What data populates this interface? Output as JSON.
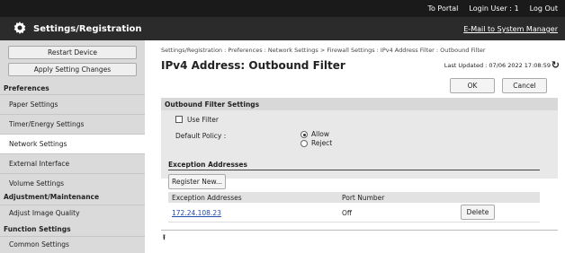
{
  "topbar": {
    "portal": "To Portal",
    "login_label": "Login User :",
    "login_user": "1",
    "logout": "Log Out"
  },
  "header": {
    "title": "Settings/Registration",
    "mail": "E-Mail to System Manager"
  },
  "sidebar": {
    "restart": "Restart Device",
    "apply": "Apply Setting Changes",
    "sections": {
      "preferences": "Preferences",
      "adjustment": "Adjustment/Maintenance",
      "function": "Function Settings"
    },
    "items": [
      "Paper Settings",
      "Timer/Energy Settings",
      "Network Settings",
      "External Interface",
      "Volume Settings",
      "Adjust Image Quality",
      "Common Settings"
    ]
  },
  "main": {
    "breadcrumb": "Settings/Registration : Preferences : Network Settings > Firewall Settings : IPv4 Address Filter : Outbound Filter",
    "title": "IPv4 Address: Outbound Filter",
    "updated": "Last Updated : 07/06 2022 17:08:59",
    "ok": "OK",
    "cancel": "Cancel",
    "panel_title": "Outbound Filter Settings",
    "use_filter": "Use Filter",
    "default_policy": "Default Policy :",
    "allow": "Allow",
    "reject": "Reject",
    "exception_title": "Exception Addresses",
    "register": "Register New...",
    "col_address": "Exception Addresses",
    "col_port": "Port Number",
    "rows": [
      {
        "address": "172.24.108.23",
        "port": "Off",
        "action": "Delete"
      }
    ]
  }
}
